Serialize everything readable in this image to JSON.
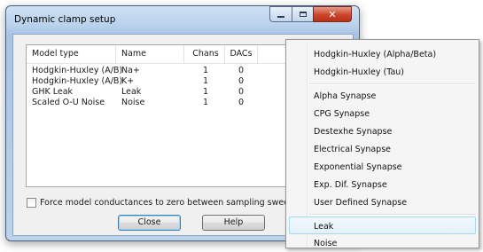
{
  "window": {
    "title": "Dynamic clamp setup"
  },
  "list": {
    "columns": [
      "Model type",
      "Name",
      "Chans",
      "DACs"
    ],
    "rows": [
      [
        "Hodgkin-Huxley (A/B)",
        "Na+",
        "1",
        "0"
      ],
      [
        "Hodgkin-Huxley (A/B)",
        "K+",
        "1",
        "0"
      ],
      [
        "GHK Leak",
        "Leak",
        "1",
        "0"
      ],
      [
        "Scaled O-U Noise",
        "Noise",
        "1",
        "0"
      ]
    ]
  },
  "checkbox": {
    "label": "Force model conductances to zero between sampling sweeps",
    "checked": false
  },
  "buttons": {
    "close": "Close",
    "help": "Help"
  },
  "menu": {
    "groups": [
      [
        "Hodgkin-Huxley (Alpha/Beta)",
        "Hodgkin-Huxley (Tau)"
      ],
      [
        "Alpha Synapse",
        "CPG Synapse",
        "Destexhe Synapse",
        "Electrical Synapse",
        "Exponential Synapse",
        "Exp. Dif. Synapse",
        "User Defined Synapse"
      ],
      [
        "Leak",
        "Noise"
      ]
    ],
    "highlighted": "Leak"
  }
}
